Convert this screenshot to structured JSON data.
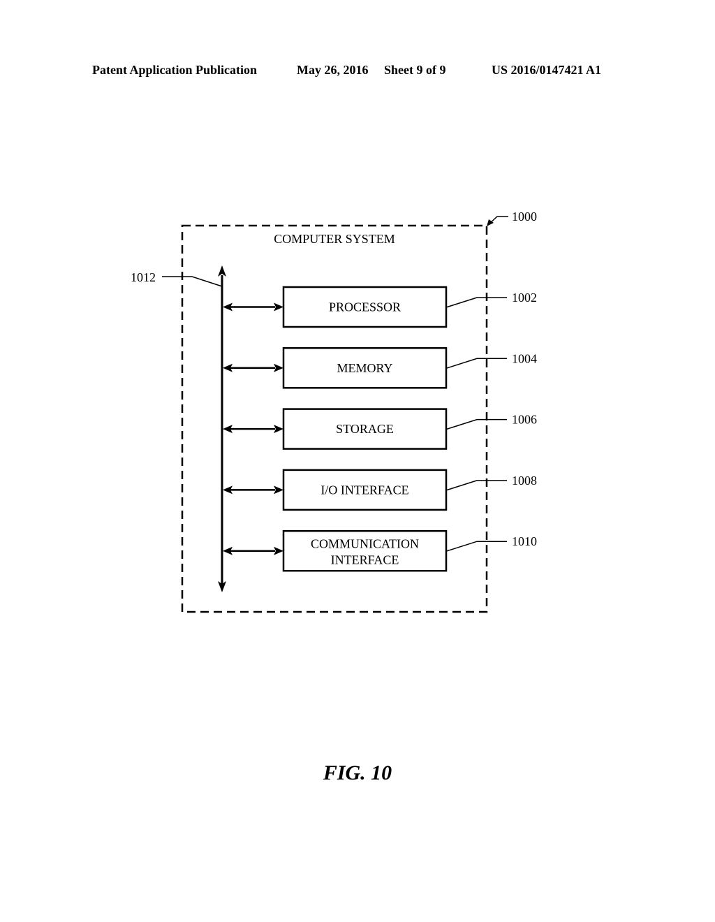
{
  "header": {
    "publication": "Patent Application Publication",
    "date": "May 26, 2016",
    "sheet": "Sheet 9 of 9",
    "number": "US 2016/0147421 A1"
  },
  "diagram": {
    "system": {
      "label": "COMPUTER SYSTEM",
      "ref": "1000"
    },
    "bus": {
      "ref": "1012"
    },
    "components": [
      {
        "line1": "PROCESSOR",
        "line2": "",
        "ref": "1002"
      },
      {
        "line1": "MEMORY",
        "line2": "",
        "ref": "1004"
      },
      {
        "line1": "STORAGE",
        "line2": "",
        "ref": "1006"
      },
      {
        "line1": "I/O INTERFACE",
        "line2": "",
        "ref": "1008"
      },
      {
        "line1": "COMMUNICATION",
        "line2": "INTERFACE",
        "ref": "1010"
      }
    ]
  },
  "figure": {
    "caption": "FIG. 10"
  }
}
